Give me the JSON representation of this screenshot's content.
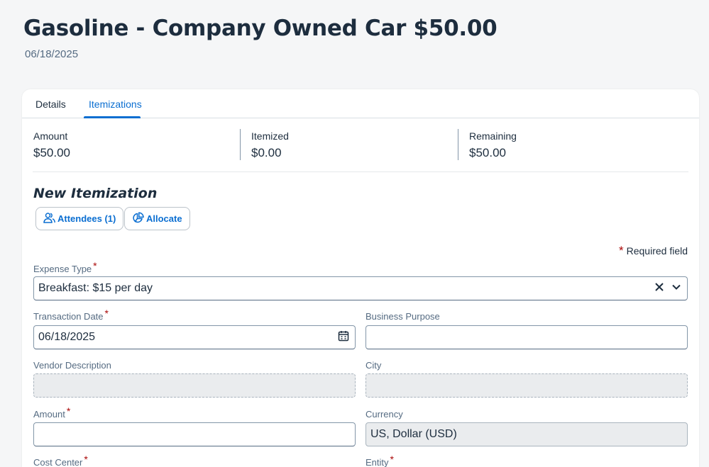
{
  "header": {
    "title": "Gasoline - Company Owned Car $50.00",
    "date": "06/18/2025"
  },
  "tabs": [
    {
      "label": "Details",
      "active": false
    },
    {
      "label": "Itemizations",
      "active": true
    }
  ],
  "summary": {
    "amount_label": "Amount",
    "amount_value": "$50.00",
    "itemized_label": "Itemized",
    "itemized_value": "$0.00",
    "remaining_label": "Remaining",
    "remaining_value": "$50.00"
  },
  "new_itemization": {
    "title": "New Itemization",
    "attendees_label": "Attendees (1)",
    "allocate_label": "Allocate",
    "required_note": "Required field"
  },
  "form": {
    "expense_type": {
      "label": "Expense Type",
      "value": "Breakfast: $15 per day"
    },
    "transaction_date": {
      "label": "Transaction Date",
      "value": "06/18/2025"
    },
    "business_purpose": {
      "label": "Business Purpose",
      "value": ""
    },
    "vendor_description": {
      "label": "Vendor Description",
      "value": ""
    },
    "city": {
      "label": "City",
      "value": ""
    },
    "amount": {
      "label": "Amount",
      "value": ""
    },
    "currency": {
      "label": "Currency",
      "value": "US, Dollar (USD)"
    },
    "cost_center": {
      "label": "Cost Center"
    },
    "entity": {
      "label": "Entity"
    }
  },
  "colors": {
    "accent": "#0a6ed1",
    "required": "#aa0808",
    "text": "#1d2d3e"
  }
}
